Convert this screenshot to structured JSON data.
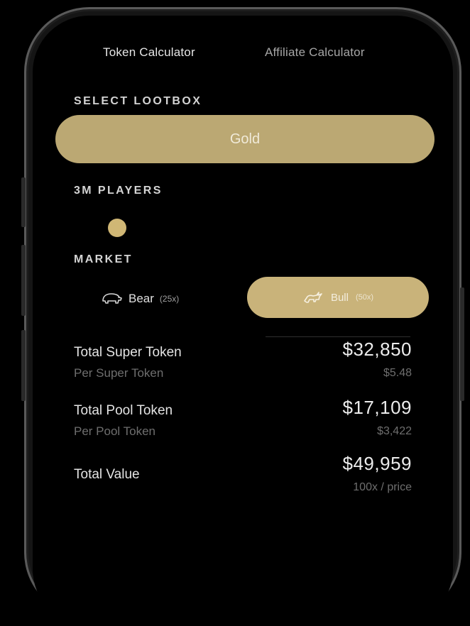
{
  "tabs": {
    "token": "Token Calculator",
    "affiliate": "Affiliate Calculator"
  },
  "lootbox": {
    "label": "SELECT LOOTBOX",
    "selected": "Gold"
  },
  "players": {
    "label": "3M PLAYERS"
  },
  "market": {
    "label": "MARKET",
    "bear": {
      "name": "Bear",
      "multiplier": "(25x)",
      "icon": "bear-icon"
    },
    "bull": {
      "name": "Bull",
      "multiplier": "(50x)",
      "icon": "bull-icon",
      "selected": true
    }
  },
  "results": {
    "super": {
      "title": "Total Super Token",
      "sub": "Per Super Token",
      "value": "$32,850",
      "subvalue": "$5.48"
    },
    "pool": {
      "title": "Total Pool Token",
      "sub": "Per Pool Token",
      "value": "$17,109",
      "subvalue": "$3,422"
    },
    "total": {
      "title": "Total Value",
      "value": "$49,959",
      "subvalue": "100x / price"
    }
  },
  "colors": {
    "gold": "#bba873",
    "gold_light": "#c9b37a",
    "background": "#000000"
  }
}
